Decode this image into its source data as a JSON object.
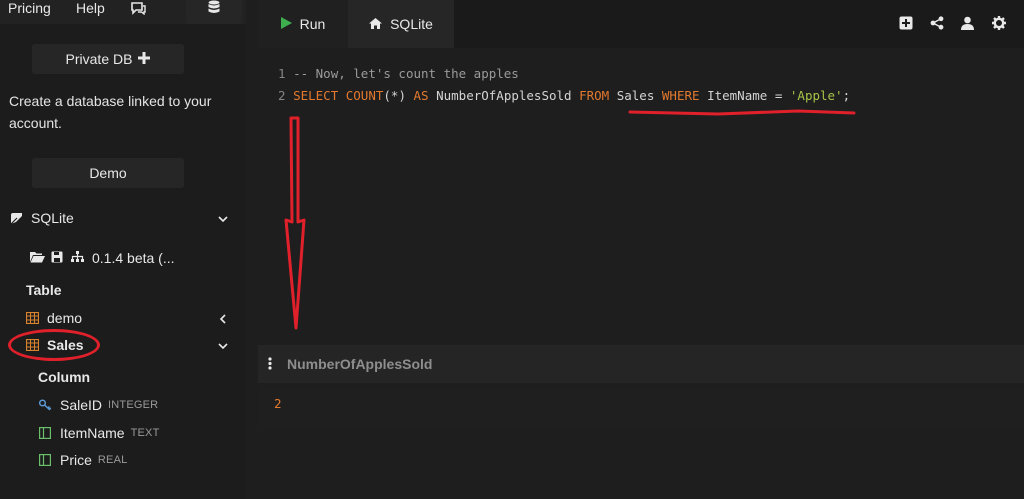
{
  "topnav": {
    "pricing": "Pricing",
    "help": "Help"
  },
  "sidebar": {
    "private_db": "Private DB",
    "create_text": "Create a database linked to your account.",
    "demo": "Demo",
    "engine": "SQLite",
    "version": "0.1.4 beta (...",
    "table_heading": "Table",
    "tables": [
      "demo",
      "Sales"
    ],
    "column_heading": "Column",
    "columns": [
      {
        "name": "SaleID",
        "type": "INTEGER"
      },
      {
        "name": "ItemName",
        "type": "TEXT"
      },
      {
        "name": "Price",
        "type": "REAL"
      }
    ]
  },
  "toolbar": {
    "run": "Run",
    "tab": "SQLite"
  },
  "editor": {
    "line1_num": "1",
    "line1_comment": "-- Now, let's count the apples",
    "line2_num": "2",
    "tok": {
      "select": "SELECT",
      "count": "COUNT",
      "args": "(*)",
      "as": "AS",
      "alias": "NumberOfApplesSold",
      "from": "FROM",
      "table": "Sales",
      "where": "WHERE",
      "col": "ItemName",
      "eq": "=",
      "str": "'Apple'",
      "semi": ";"
    }
  },
  "result": {
    "column": "NumberOfApplesSold",
    "value": "2"
  },
  "colors": {
    "keyword": "#e2792f",
    "string": "#a6c24a",
    "annotation": "#e0202a",
    "run_icon": "#3fae4f",
    "table_icon": "#d9832f",
    "key_icon": "#5b9ad6",
    "column_icon": "#6bbf6b"
  }
}
